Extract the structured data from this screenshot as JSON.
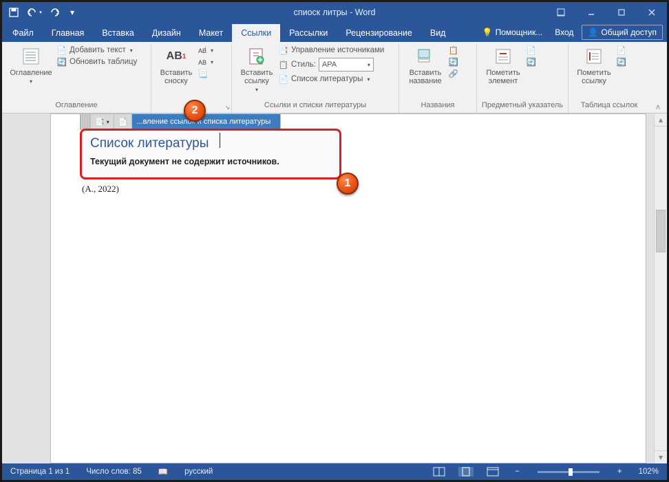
{
  "title": "спиоск литры - Word",
  "qat": {
    "save": "save",
    "undo": "undo",
    "redo": "redo"
  },
  "tabs": {
    "file": "Файл",
    "home": "Главная",
    "insert": "Вставка",
    "design": "Дизайн",
    "layout": "Макет",
    "references": "Ссылки",
    "mailings": "Рассылки",
    "review": "Рецензирование",
    "view": "Вид",
    "tellme": "Помощник...",
    "signin": "Вход",
    "share": "Общий доступ"
  },
  "ribbon": {
    "toc": {
      "big": "Оглавление",
      "add_text": "Добавить текст",
      "update": "Обновить таблицу",
      "group": "Оглавление"
    },
    "footnotes": {
      "big": "Вставить\nсноску",
      "ab": "AB",
      "group": ""
    },
    "citations": {
      "big": "Вставить\nссылку",
      "manage": "Управление источниками",
      "style_label": "Стиль:",
      "style_value": "APA",
      "biblio": "Список литературы",
      "group": "Ссылки и списки литературы"
    },
    "captions": {
      "big": "Вставить\nназвание",
      "group": "Названия"
    },
    "index": {
      "big": "Пометить\nэлемент",
      "group": "Предметный указатель"
    },
    "authorities": {
      "big": "Пометить\nссылку",
      "group": "Таблица ссылок"
    }
  },
  "doc": {
    "update_text": "...вление ссылок и списка литературы",
    "bib_title": "Список литературы",
    "bib_body": "Текущий документ не содержит источников.",
    "citation": "(A., 2022)"
  },
  "badges": {
    "one": "1",
    "two": "2"
  },
  "status": {
    "page": "Страница 1 из 1",
    "words": "Число слов: 85",
    "lang": "русский",
    "zoom": "102%"
  }
}
